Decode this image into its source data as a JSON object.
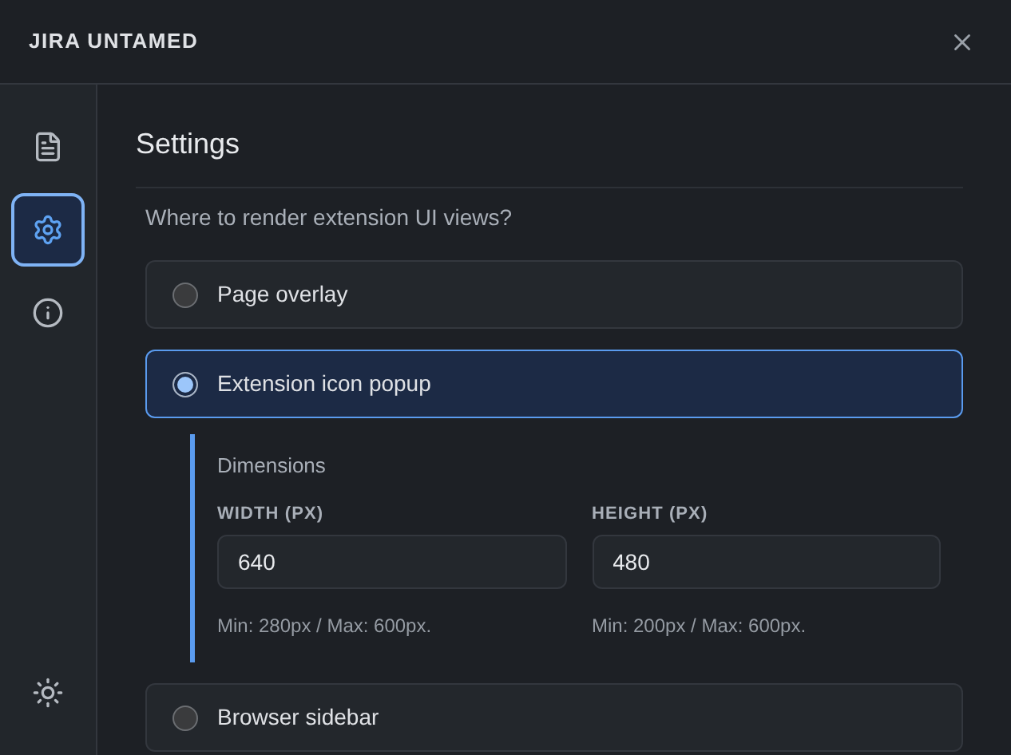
{
  "window": {
    "title": "JIRA UNTAMED"
  },
  "sidebar": {
    "items": [
      {
        "kind": "document",
        "selected": false
      },
      {
        "kind": "settings",
        "selected": true
      },
      {
        "kind": "info",
        "selected": false
      }
    ],
    "footer": {
      "kind": "theme"
    }
  },
  "settings": {
    "title": "Settings",
    "question": "Where to render extension UI views?",
    "options": [
      {
        "label": "Page overlay",
        "selected": false
      },
      {
        "label": "Extension icon popup",
        "selected": true,
        "dimensions": {
          "title": "Dimensions",
          "fields": [
            {
              "label": "WIDTH (PX)",
              "value": "640",
              "hint": "Min: 280px / Max: 600px."
            },
            {
              "label": "HEIGHT (PX)",
              "value": "480",
              "hint": "Min: 200px / Max: 600px."
            }
          ]
        }
      },
      {
        "label": "Browser sidebar",
        "selected": false
      }
    ]
  }
}
